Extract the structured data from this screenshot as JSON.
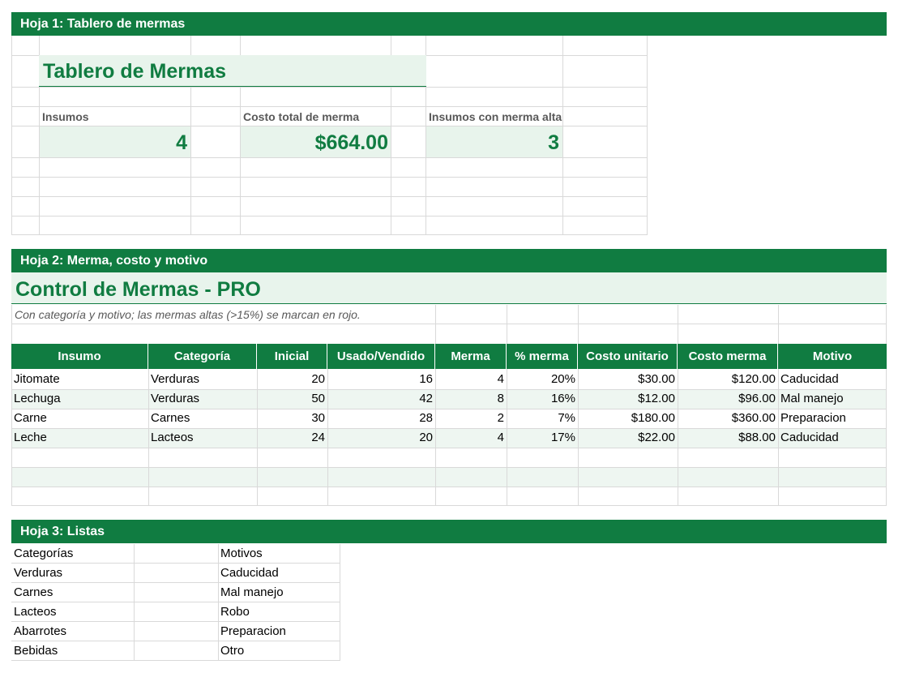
{
  "sheet1": {
    "bar": "Hoja 1: Tablero de mermas",
    "title": "Tablero de Mermas",
    "kpis": [
      {
        "label": "Insumos",
        "value": "4"
      },
      {
        "label": "Costo total de merma",
        "value": "$664.00"
      },
      {
        "label": "Insumos con merma alta",
        "value": "3"
      }
    ]
  },
  "sheet2": {
    "bar": "Hoja 2: Merma, costo y motivo",
    "title": "Control de Mermas - PRO",
    "subtitle": "Con categoría y motivo; las mermas altas (>15%) se marcan en rojo.",
    "headers": [
      "Insumo",
      "Categoría",
      "Inicial",
      "Usado/Vendido",
      "Merma",
      "% merma",
      "Costo unitario",
      "Costo merma",
      "Motivo"
    ],
    "rows": [
      [
        "Jitomate",
        "Verduras",
        "20",
        "16",
        "4",
        "20%",
        "$30.00",
        "$120.00",
        "Caducidad"
      ],
      [
        "Lechuga",
        "Verduras",
        "50",
        "42",
        "8",
        "16%",
        "$12.00",
        "$96.00",
        "Mal manejo"
      ],
      [
        "Carne",
        "Carnes",
        "30",
        "28",
        "2",
        "7%",
        "$180.00",
        "$360.00",
        "Preparacion"
      ],
      [
        "Leche",
        "Lacteos",
        "24",
        "20",
        "4",
        "17%",
        "$22.00",
        "$88.00",
        "Caducidad"
      ]
    ]
  },
  "sheet3": {
    "bar": "Hoja 3: Listas",
    "categories_header": "Categorías",
    "categories": [
      "Verduras",
      "Carnes",
      "Lacteos",
      "Abarrotes",
      "Bebidas"
    ],
    "motivos_header": "Motivos",
    "motivos": [
      "Caducidad",
      "Mal manejo",
      "Robo",
      "Preparacion",
      "Otro"
    ]
  },
  "colors": {
    "accent": "#107c41",
    "light": "#e8f4ec",
    "grid": "#d9d9d9",
    "label": "#595959"
  }
}
